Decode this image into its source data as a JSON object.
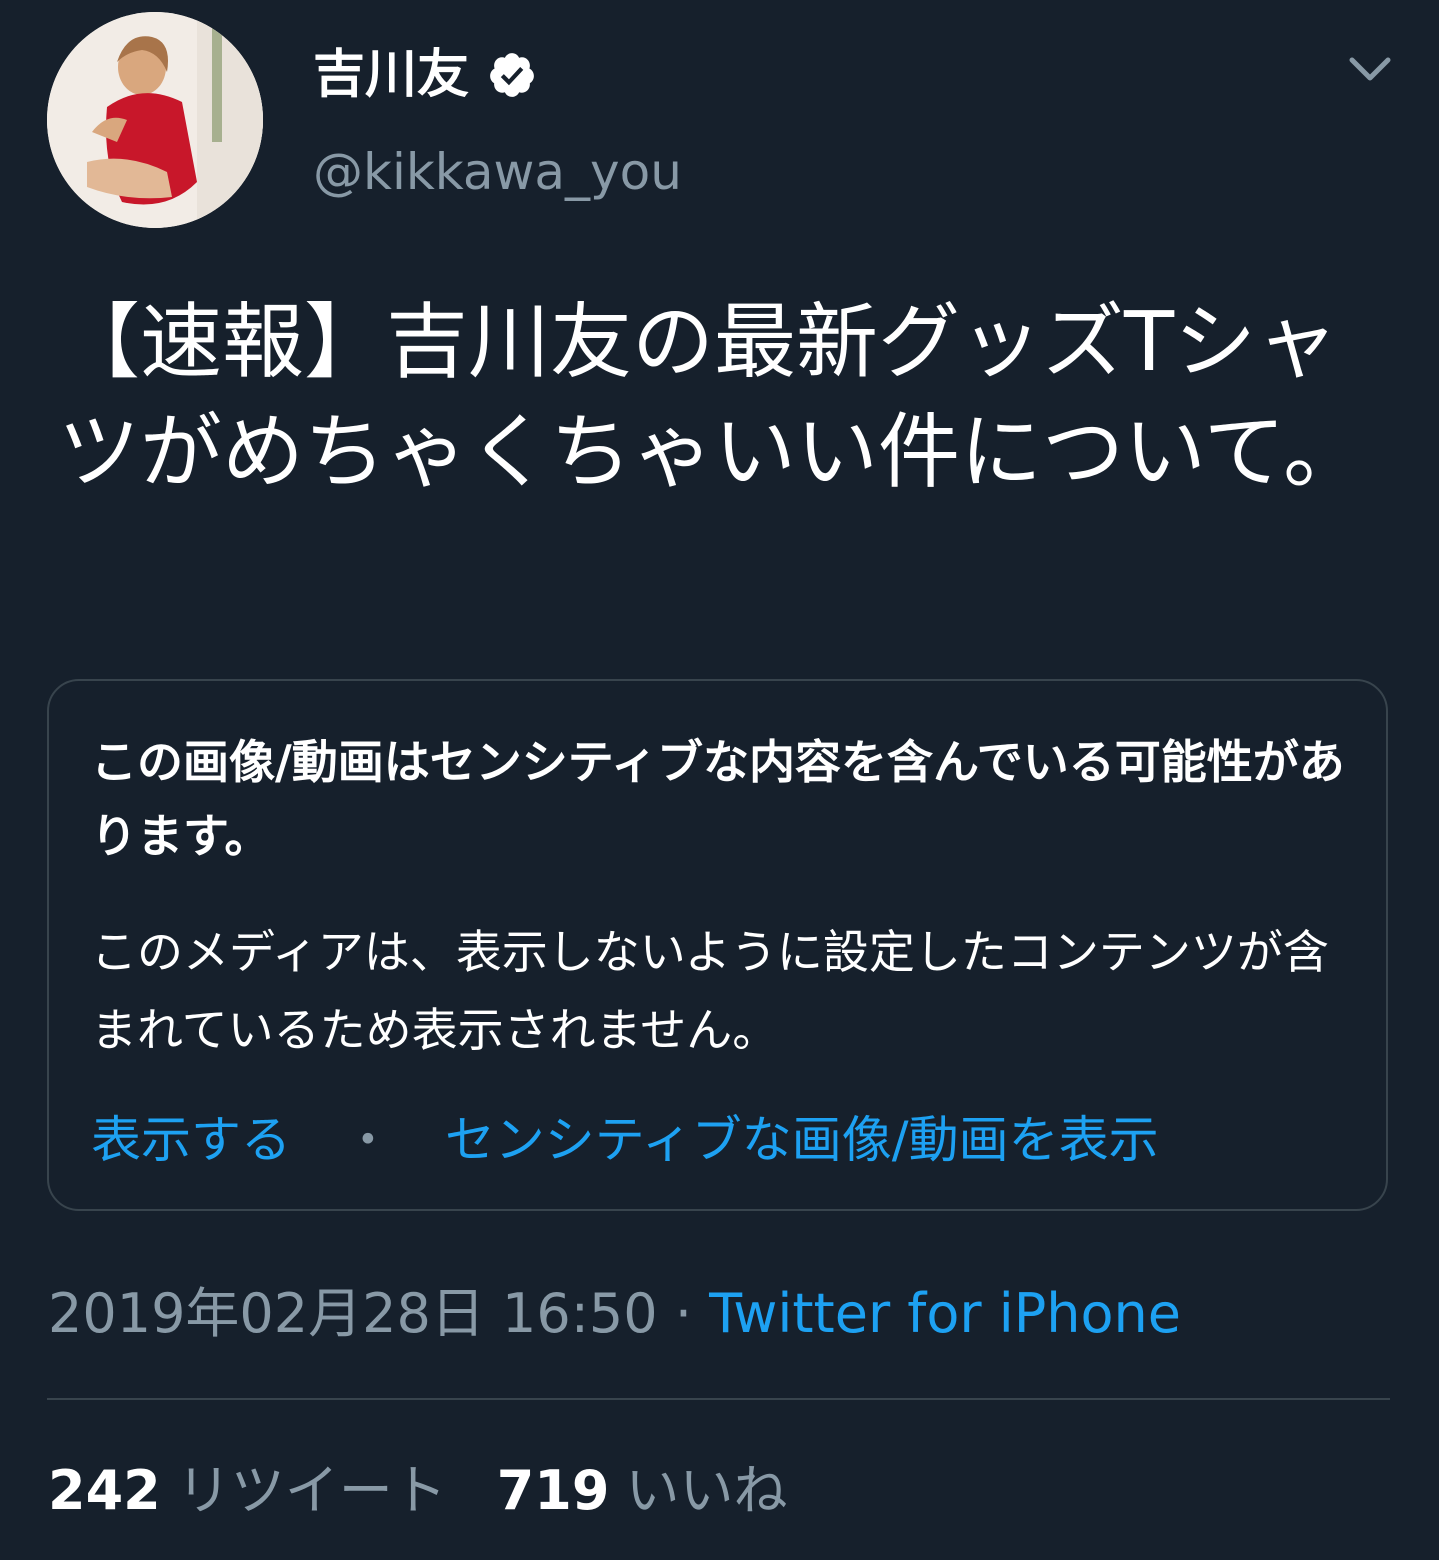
{
  "user": {
    "display_name": "吉川友",
    "handle": "@kikkawa_you",
    "verified": true
  },
  "icons": {
    "verified": "verified-badge-icon",
    "menu": "chevron-down-icon"
  },
  "tweet": {
    "text": "【速報】吉川友の最新グッズTシャツがめちゃくちゃいい件について。"
  },
  "media_warning": {
    "title": "この画像/動画はセンシティブな内容を含んでいる可能性があります。",
    "description": "このメディアは、表示しないように設定したコンテンツが含まれているため表示されません。",
    "show_label": "表示する",
    "separator": "・",
    "settings_label": "センシティブな画像/動画を表示"
  },
  "meta": {
    "timestamp": "2019年02月28日 16:50",
    "separator": "·",
    "source": "Twitter for iPhone"
  },
  "stats": {
    "retweets_count": "242",
    "retweets_label": "リツイート",
    "likes_count": "719",
    "likes_label": "いいね"
  },
  "colors": {
    "background": "#16202c",
    "text": "#ffffff",
    "secondary": "#8899a6",
    "accent": "#1da1f2",
    "border": "#38444d"
  }
}
